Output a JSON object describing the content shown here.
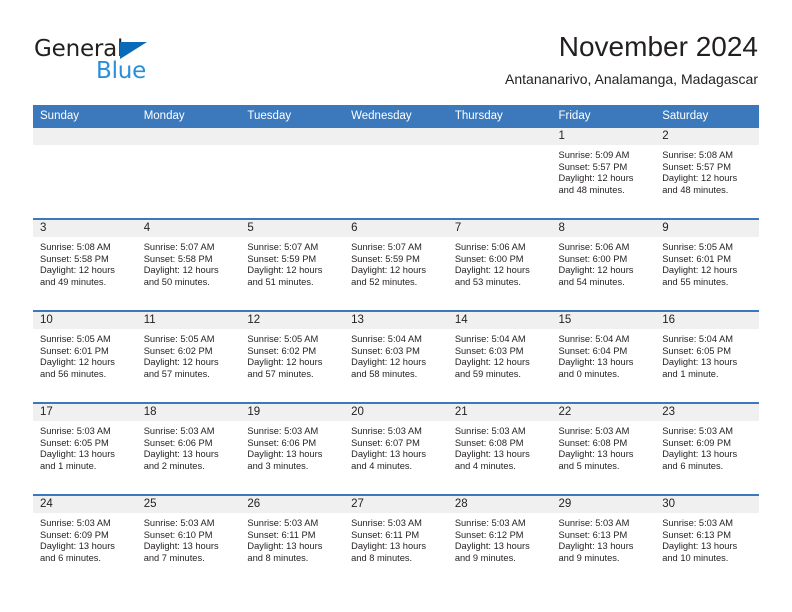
{
  "brand": {
    "name_top": "General",
    "name_bottom": "Blue",
    "triangle_color": "#0a6ab8",
    "blue_color": "#2a8fd8"
  },
  "header": {
    "title": "November 2024",
    "subtitle": "Antananarivo, Analamanga, Madagascar"
  },
  "theme": {
    "header_blue": "#3b79bc",
    "date_band_gray": "#f0f0f0",
    "text_color": "#231f20"
  },
  "calendar": {
    "weekday_headers": [
      "Sunday",
      "Monday",
      "Tuesday",
      "Wednesday",
      "Thursday",
      "Friday",
      "Saturday"
    ],
    "weeks": [
      [
        {
          "day": "",
          "lines": []
        },
        {
          "day": "",
          "lines": []
        },
        {
          "day": "",
          "lines": []
        },
        {
          "day": "",
          "lines": []
        },
        {
          "day": "",
          "lines": []
        },
        {
          "day": "1",
          "lines": [
            "Sunrise: 5:09 AM",
            "Sunset: 5:57 PM",
            "Daylight: 12 hours and 48 minutes."
          ]
        },
        {
          "day": "2",
          "lines": [
            "Sunrise: 5:08 AM",
            "Sunset: 5:57 PM",
            "Daylight: 12 hours and 48 minutes."
          ]
        }
      ],
      [
        {
          "day": "3",
          "lines": [
            "Sunrise: 5:08 AM",
            "Sunset: 5:58 PM",
            "Daylight: 12 hours and 49 minutes."
          ]
        },
        {
          "day": "4",
          "lines": [
            "Sunrise: 5:07 AM",
            "Sunset: 5:58 PM",
            "Daylight: 12 hours and 50 minutes."
          ]
        },
        {
          "day": "5",
          "lines": [
            "Sunrise: 5:07 AM",
            "Sunset: 5:59 PM",
            "Daylight: 12 hours and 51 minutes."
          ]
        },
        {
          "day": "6",
          "lines": [
            "Sunrise: 5:07 AM",
            "Sunset: 5:59 PM",
            "Daylight: 12 hours and 52 minutes."
          ]
        },
        {
          "day": "7",
          "lines": [
            "Sunrise: 5:06 AM",
            "Sunset: 6:00 PM",
            "Daylight: 12 hours and 53 minutes."
          ]
        },
        {
          "day": "8",
          "lines": [
            "Sunrise: 5:06 AM",
            "Sunset: 6:00 PM",
            "Daylight: 12 hours and 54 minutes."
          ]
        },
        {
          "day": "9",
          "lines": [
            "Sunrise: 5:05 AM",
            "Sunset: 6:01 PM",
            "Daylight: 12 hours and 55 minutes."
          ]
        }
      ],
      [
        {
          "day": "10",
          "lines": [
            "Sunrise: 5:05 AM",
            "Sunset: 6:01 PM",
            "Daylight: 12 hours and 56 minutes."
          ]
        },
        {
          "day": "11",
          "lines": [
            "Sunrise: 5:05 AM",
            "Sunset: 6:02 PM",
            "Daylight: 12 hours and 57 minutes."
          ]
        },
        {
          "day": "12",
          "lines": [
            "Sunrise: 5:05 AM",
            "Sunset: 6:02 PM",
            "Daylight: 12 hours and 57 minutes."
          ]
        },
        {
          "day": "13",
          "lines": [
            "Sunrise: 5:04 AM",
            "Sunset: 6:03 PM",
            "Daylight: 12 hours and 58 minutes."
          ]
        },
        {
          "day": "14",
          "lines": [
            "Sunrise: 5:04 AM",
            "Sunset: 6:03 PM",
            "Daylight: 12 hours and 59 minutes."
          ]
        },
        {
          "day": "15",
          "lines": [
            "Sunrise: 5:04 AM",
            "Sunset: 6:04 PM",
            "Daylight: 13 hours and 0 minutes."
          ]
        },
        {
          "day": "16",
          "lines": [
            "Sunrise: 5:04 AM",
            "Sunset: 6:05 PM",
            "Daylight: 13 hours and 1 minute."
          ]
        }
      ],
      [
        {
          "day": "17",
          "lines": [
            "Sunrise: 5:03 AM",
            "Sunset: 6:05 PM",
            "Daylight: 13 hours and 1 minute."
          ]
        },
        {
          "day": "18",
          "lines": [
            "Sunrise: 5:03 AM",
            "Sunset: 6:06 PM",
            "Daylight: 13 hours and 2 minutes."
          ]
        },
        {
          "day": "19",
          "lines": [
            "Sunrise: 5:03 AM",
            "Sunset: 6:06 PM",
            "Daylight: 13 hours and 3 minutes."
          ]
        },
        {
          "day": "20",
          "lines": [
            "Sunrise: 5:03 AM",
            "Sunset: 6:07 PM",
            "Daylight: 13 hours and 4 minutes."
          ]
        },
        {
          "day": "21",
          "lines": [
            "Sunrise: 5:03 AM",
            "Sunset: 6:08 PM",
            "Daylight: 13 hours and 4 minutes."
          ]
        },
        {
          "day": "22",
          "lines": [
            "Sunrise: 5:03 AM",
            "Sunset: 6:08 PM",
            "Daylight: 13 hours and 5 minutes."
          ]
        },
        {
          "day": "23",
          "lines": [
            "Sunrise: 5:03 AM",
            "Sunset: 6:09 PM",
            "Daylight: 13 hours and 6 minutes."
          ]
        }
      ],
      [
        {
          "day": "24",
          "lines": [
            "Sunrise: 5:03 AM",
            "Sunset: 6:09 PM",
            "Daylight: 13 hours and 6 minutes."
          ]
        },
        {
          "day": "25",
          "lines": [
            "Sunrise: 5:03 AM",
            "Sunset: 6:10 PM",
            "Daylight: 13 hours and 7 minutes."
          ]
        },
        {
          "day": "26",
          "lines": [
            "Sunrise: 5:03 AM",
            "Sunset: 6:11 PM",
            "Daylight: 13 hours and 8 minutes."
          ]
        },
        {
          "day": "27",
          "lines": [
            "Sunrise: 5:03 AM",
            "Sunset: 6:11 PM",
            "Daylight: 13 hours and 8 minutes."
          ]
        },
        {
          "day": "28",
          "lines": [
            "Sunrise: 5:03 AM",
            "Sunset: 6:12 PM",
            "Daylight: 13 hours and 9 minutes."
          ]
        },
        {
          "day": "29",
          "lines": [
            "Sunrise: 5:03 AM",
            "Sunset: 6:13 PM",
            "Daylight: 13 hours and 9 minutes."
          ]
        },
        {
          "day": "30",
          "lines": [
            "Sunrise: 5:03 AM",
            "Sunset: 6:13 PM",
            "Daylight: 13 hours and 10 minutes."
          ]
        }
      ]
    ]
  }
}
